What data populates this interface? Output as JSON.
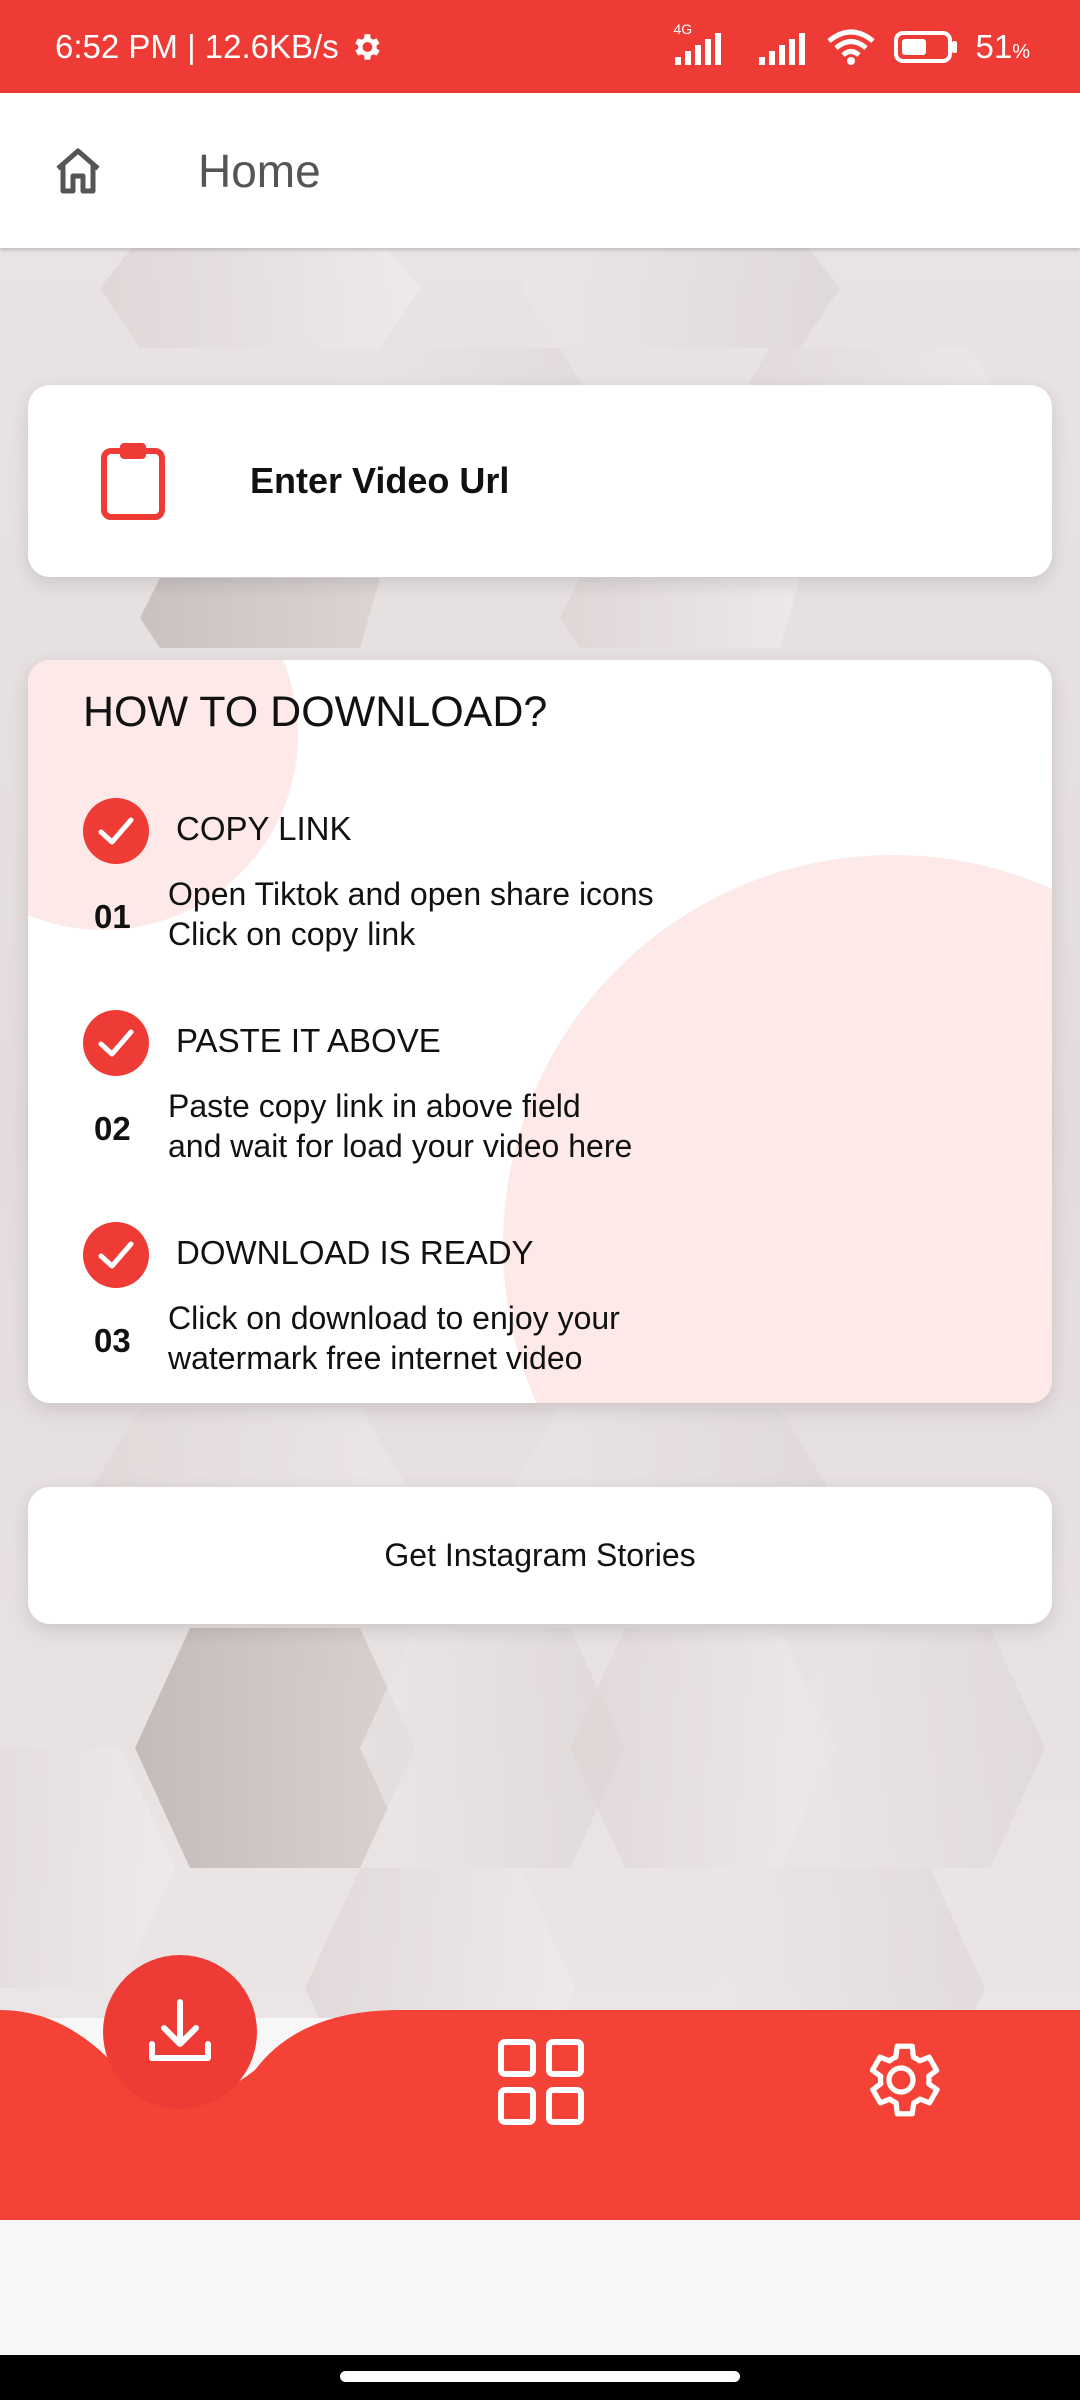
{
  "status_bar": {
    "time": "6:52 PM | 12.6KB/s",
    "network": "4G",
    "battery": "51",
    "battery_unit": "%",
    "icons": [
      "gear-icon",
      "signal-icon",
      "signal-icon",
      "wifi-icon",
      "battery-icon"
    ]
  },
  "app_bar": {
    "title": "Home",
    "icon": "home-icon"
  },
  "url_card": {
    "placeholder": "Enter Video Url",
    "icon": "clipboard-icon"
  },
  "howto": {
    "title": "HOW TO DOWNLOAD?",
    "steps": [
      {
        "title": "COPY LINK",
        "number": "01",
        "desc_line1": "Open Tiktok and open share icons",
        "desc_line2": "Click on copy link"
      },
      {
        "title": "PASTE IT ABOVE",
        "number": "02",
        "desc_line1": "Paste copy link in above field",
        "desc_line2": "and wait for load your video here"
      },
      {
        "title": "DOWNLOAD IS READY",
        "number": "03",
        "desc_line1": "Click on download to enjoy your",
        "desc_line2": "watermark free internet video"
      }
    ]
  },
  "instagram_button": {
    "label": "Get Instagram Stories"
  },
  "bottom_nav": {
    "items": [
      "download-icon",
      "grid-icon",
      "gear-icon"
    ]
  },
  "colors": {
    "accent": "#ee3b35",
    "blob": "#fde9e8",
    "background": "#e9e3e3"
  }
}
